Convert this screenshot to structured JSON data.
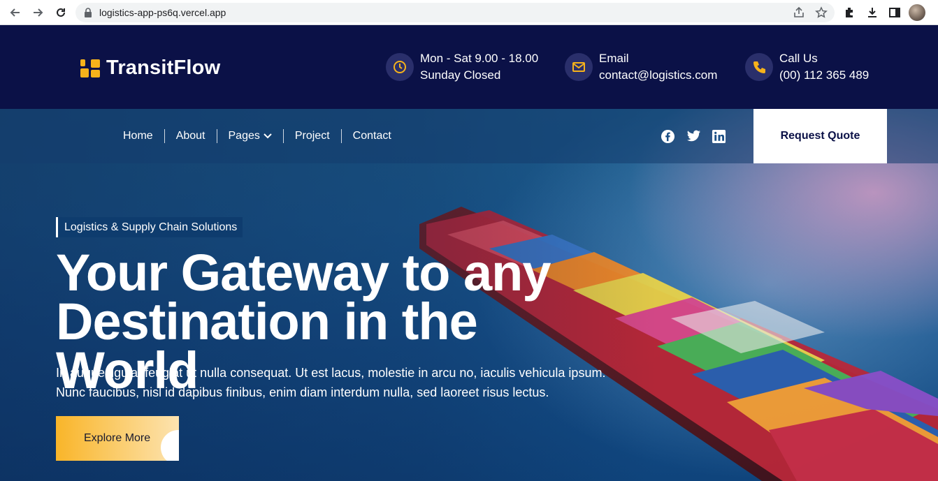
{
  "browser": {
    "url": "logistics-app-ps6q.vercel.app",
    "icons": [
      "back-icon",
      "forward-icon",
      "reload-icon",
      "lock-icon",
      "share-icon",
      "star-icon",
      "extensions-icon",
      "download-icon",
      "sidepanel-icon",
      "profile-avatar"
    ]
  },
  "brand": {
    "name": "TransitFlow",
    "accent": "#f6b21b",
    "dark": "#0b1147"
  },
  "contact": {
    "hours": {
      "line1": "Mon - Sat 9.00 - 18.00",
      "line2": "Sunday Closed",
      "icon": "clock-icon"
    },
    "email": {
      "line1": "Email",
      "line2": "contact@logistics.com",
      "icon": "mail-icon"
    },
    "phone": {
      "line1": "Call Us",
      "line2": "(00) 112 365 489",
      "icon": "phone-icon"
    }
  },
  "nav": {
    "items": [
      {
        "label": "Home"
      },
      {
        "label": "About"
      },
      {
        "label": "Pages"
      },
      {
        "label": "Project"
      },
      {
        "label": "Contact"
      }
    ],
    "social": [
      "facebook-icon",
      "twitter-icon",
      "linkedin-icon"
    ],
    "quote_label": "Request Quote"
  },
  "hero": {
    "tagline": "Logistics & Supply Chain Solutions",
    "headline_line1": "Your Gateway to any",
    "headline_line2": "Destination in the World",
    "sub_line1": "In augue ligula, feugiat ut nulla consequat. Ut est lacus, molestie in arcu no, iaculis vehicula ipsum.",
    "sub_line2": "Nunc faucibus, nisl id dapibus finibus, enim diam interdum nulla, sed laoreet risus lectus.",
    "cta_label": "Explore More"
  }
}
